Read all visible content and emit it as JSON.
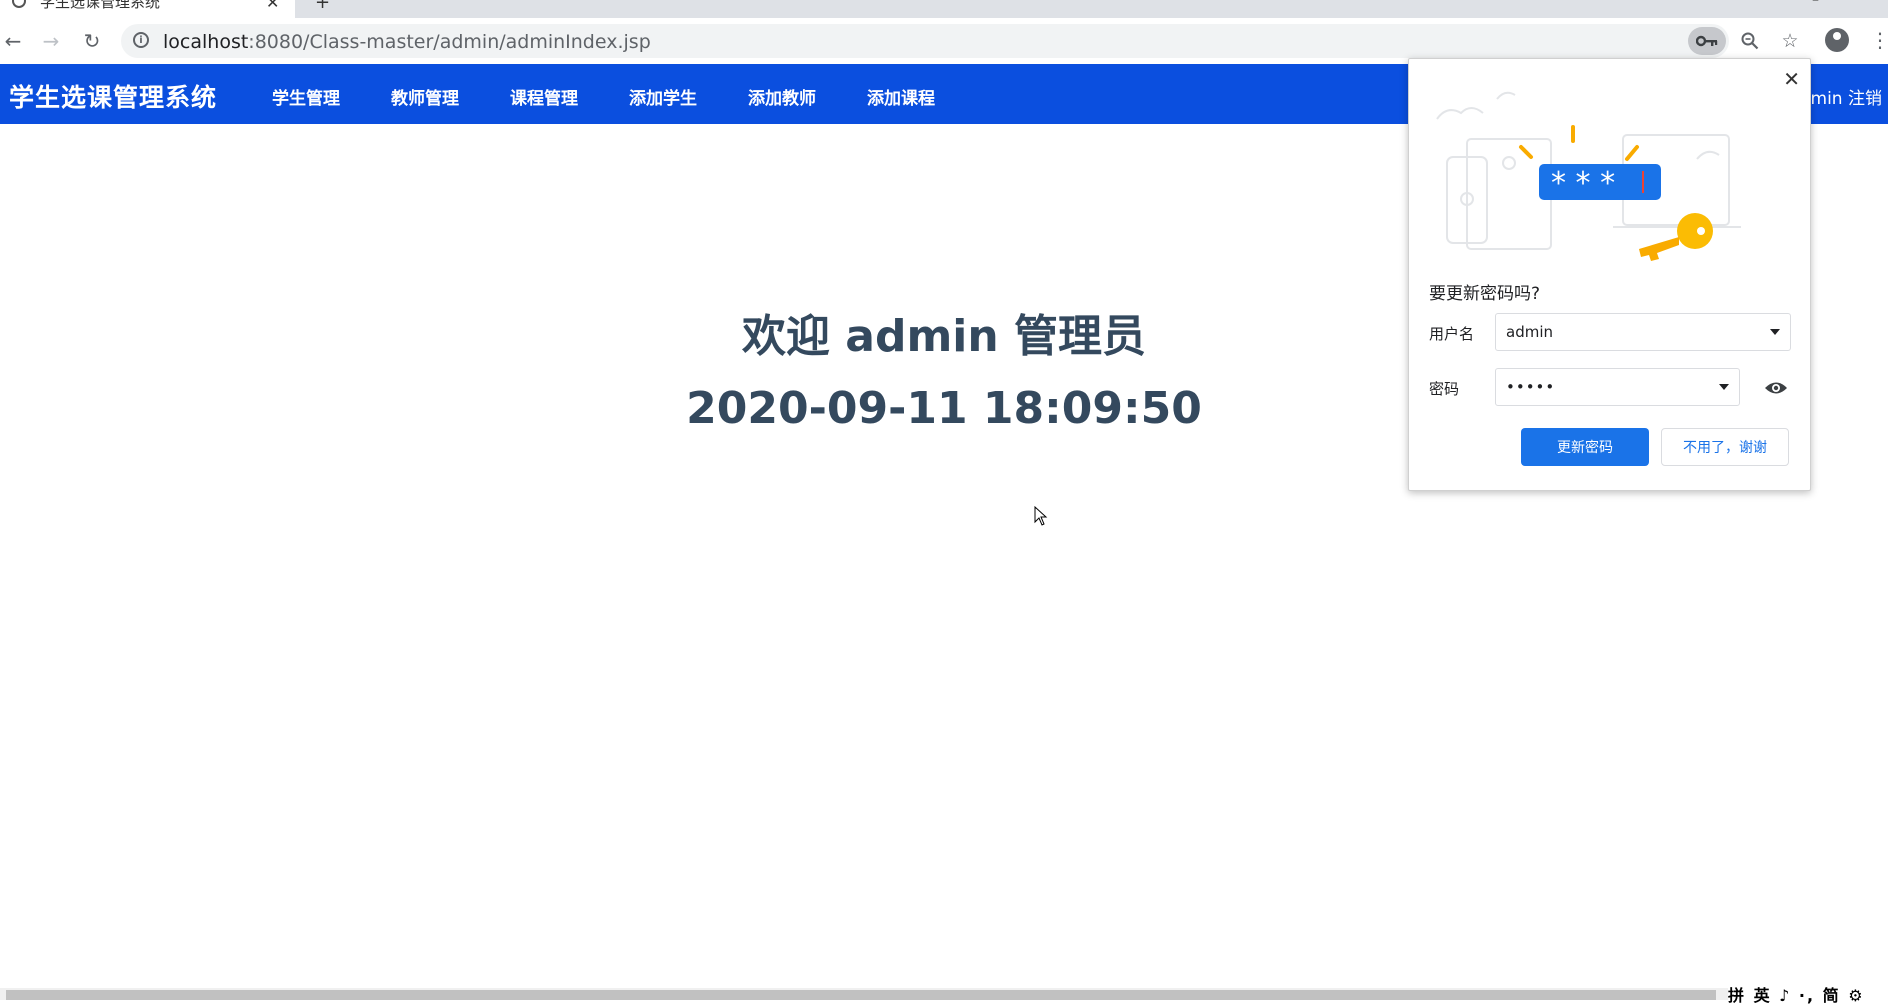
{
  "browser": {
    "tab_title": "学生选课管理系统",
    "url_host": "localhost",
    "url_rest": ":8080/Class-master/admin/adminIndex.jsp"
  },
  "navbar": {
    "brand": "学生选课管理系统",
    "links": [
      "学生管理",
      "教师管理",
      "课程管理",
      "添加学生",
      "添加教师",
      "添加课程"
    ],
    "user_logout": "dmin 注销",
    "background": "#0b4fdf"
  },
  "main": {
    "welcome": "欢迎 admin 管理员",
    "datetime": "2020-09-11 18:09:50",
    "text_color": "#34495e"
  },
  "password_bubble": {
    "heading": "要更新密码吗?",
    "username_label": "用户名",
    "username_value": "admin",
    "password_label": "密码",
    "password_value": "•••••",
    "update_button": "更新密码",
    "no_thanks_button": "不用了，谢谢",
    "accent": "#1a73e8"
  },
  "ime": {
    "text": "拼 英 ♪ ·, 简 ⚙"
  }
}
